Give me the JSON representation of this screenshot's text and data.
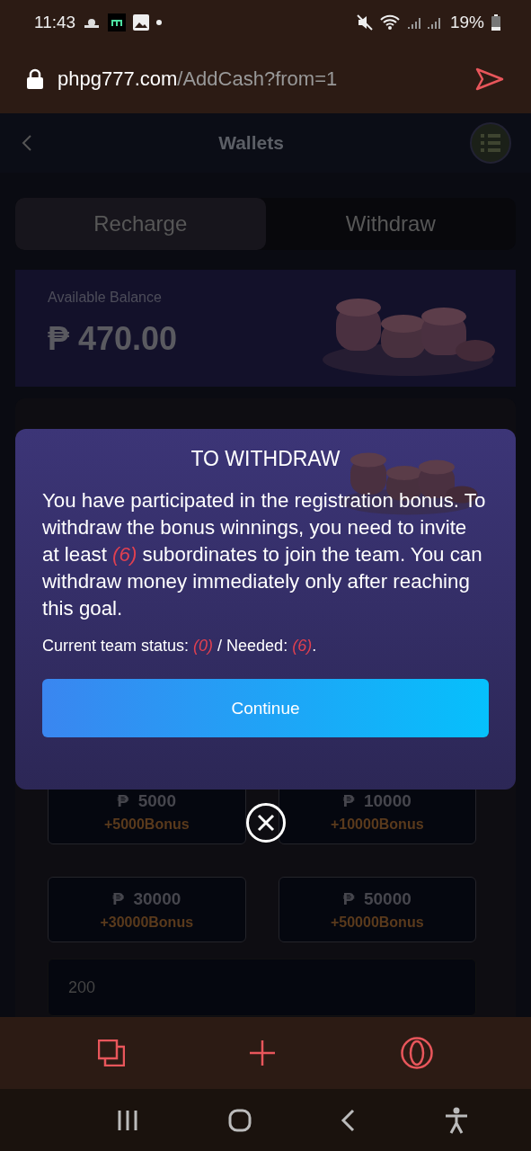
{
  "status_bar": {
    "time": "11:43",
    "battery": "19%"
  },
  "url_bar": {
    "host": "phpg777.com",
    "path": "/AddCash?from=1"
  },
  "header": {
    "title": "Wallets"
  },
  "tabs": [
    {
      "label": "Recharge",
      "selected": true
    },
    {
      "label": "Withdraw",
      "selected": false
    }
  ],
  "balance": {
    "label": "Available Balance",
    "currency": "₱",
    "amount": "470.00"
  },
  "amounts": [
    {
      "currency": "₱",
      "value": "5000",
      "bonus": "+5000Bonus"
    },
    {
      "currency": "₱",
      "value": "10000",
      "bonus": "+10000Bonus"
    },
    {
      "currency": "₱",
      "value": "30000",
      "bonus": "+30000Bonus"
    },
    {
      "currency": "₱",
      "value": "50000",
      "bonus": "+50000Bonus"
    }
  ],
  "amount_field": {
    "value": "200"
  },
  "dialog": {
    "title": "TO WITHDRAW",
    "message": "You have participated in the registration bonus. To withdraw the bonus winnings, you need to invite at least *(6)* subordinates to join the team. You can withdraw money immediately only after reaching this goal.",
    "status": "Current team status: *(0)* / Needed: *(6)*.",
    "button": "Continue"
  }
}
